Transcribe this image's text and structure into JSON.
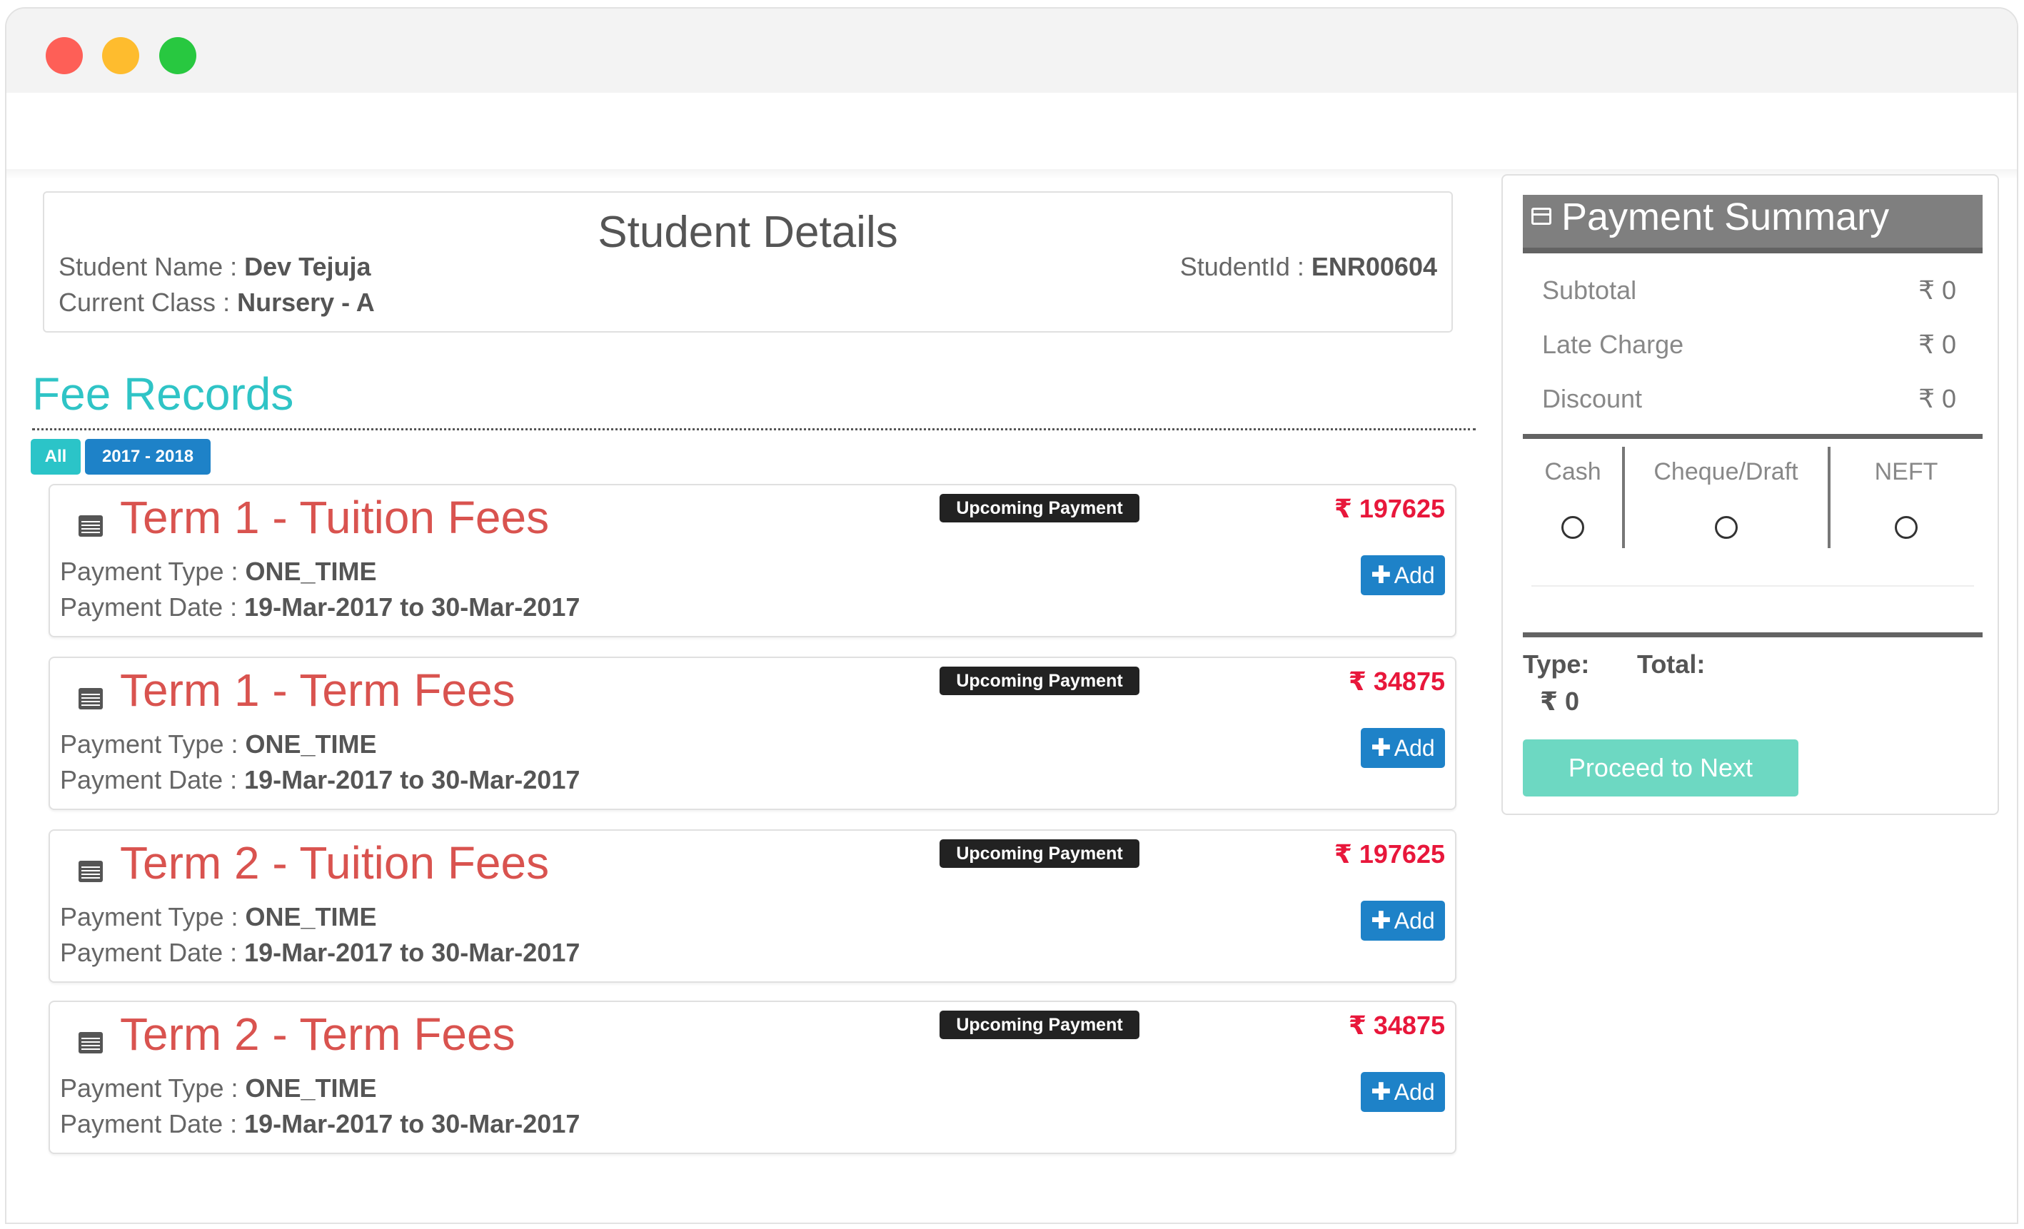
{
  "window": {
    "controls": [
      "close",
      "minimize",
      "maximize"
    ]
  },
  "student_details": {
    "title": "Student Details",
    "name_label": "Student Name : ",
    "name_value": "Dev Tejuja",
    "class_label": "Current Class : ",
    "class_value": "Nursery - A",
    "id_label": "StudentId : ",
    "id_value": "ENR00604"
  },
  "fee_records": {
    "heading": "Fee Records",
    "filters": [
      {
        "label": "All",
        "active": true
      },
      {
        "label": "2017 - 2018",
        "active": false
      }
    ],
    "items": [
      {
        "title": "Term 1 - Tuition Fees",
        "badge": "Upcoming Payment",
        "amount": "₹ 197625",
        "type_label": "Payment Type : ",
        "type_value": "ONE_TIME",
        "date_label": "Payment Date : ",
        "date_value": "19-Mar-2017 to 30-Mar-2017",
        "add_label": "Add"
      },
      {
        "title": "Term 1 - Term Fees",
        "badge": "Upcoming Payment",
        "amount": "₹ 34875",
        "type_label": "Payment Type : ",
        "type_value": "ONE_TIME",
        "date_label": "Payment Date : ",
        "date_value": "19-Mar-2017 to 30-Mar-2017",
        "add_label": "Add"
      },
      {
        "title": "Term 2 - Tuition Fees",
        "badge": "Upcoming Payment",
        "amount": "₹ 197625",
        "type_label": "Payment Type : ",
        "type_value": "ONE_TIME",
        "date_label": "Payment Date : ",
        "date_value": "19-Mar-2017 to 30-Mar-2017",
        "add_label": "Add"
      },
      {
        "title": "Term 2 - Term Fees",
        "badge": "Upcoming Payment",
        "amount": "₹ 34875",
        "type_label": "Payment Type : ",
        "type_value": "ONE_TIME",
        "date_label": "Payment Date : ",
        "date_value": "19-Mar-2017 to 30-Mar-2017",
        "add_label": "Add"
      }
    ]
  },
  "payment_summary": {
    "title": "Payment Summary",
    "rows": [
      {
        "label": "Subtotal",
        "value": "₹ 0"
      },
      {
        "label": "Late Charge",
        "value": "₹ 0"
      },
      {
        "label": "Discount",
        "value": "₹ 0"
      }
    ],
    "modes": [
      {
        "label": "Cash",
        "selected": false
      },
      {
        "label": "Cheque/Draft",
        "selected": false
      },
      {
        "label": "NEFT",
        "selected": false
      }
    ],
    "type_label": "Type:",
    "total_label": "Total:",
    "type_value": "₹ 0",
    "proceed_label": "Proceed to Next"
  },
  "colors": {
    "accent_teal": "#2fc4c6",
    "fee_title_red": "#d9534f",
    "amount_red": "#e8173b",
    "primary_blue": "#1e82c8",
    "proceed_green": "#6dd8c2",
    "summary_header": "#7f7f7f"
  }
}
